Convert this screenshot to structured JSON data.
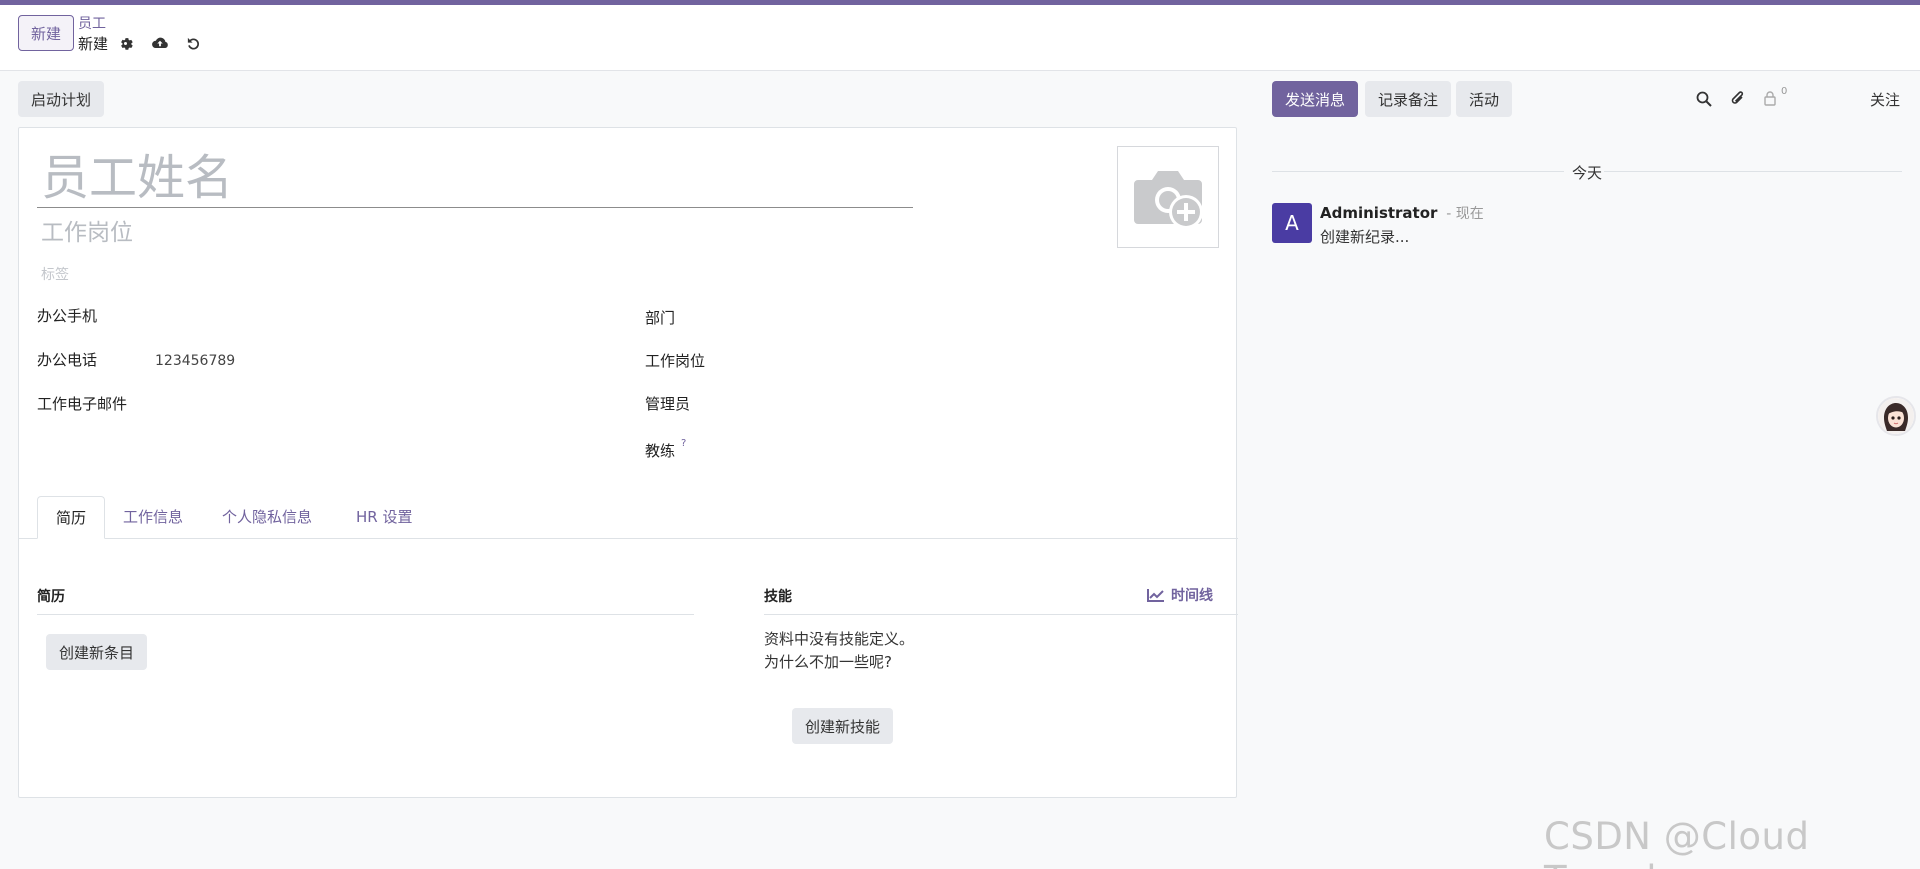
{
  "control_panel": {
    "new_button": "新建",
    "breadcrumb_parent": "员工",
    "breadcrumb_current": "新建",
    "icons": [
      "gear-icon",
      "cloud-upload-icon",
      "undo-icon"
    ]
  },
  "statusbar": {
    "launch_plan": "启动计划"
  },
  "form": {
    "name_placeholder": "员工姓名",
    "job_title_placeholder": "工作岗位",
    "tags_placeholder": "标签",
    "left_fields": [
      {
        "label": "办公手机",
        "value": ""
      },
      {
        "label": "办公电话",
        "value": "123456789"
      },
      {
        "label": "工作电子邮件",
        "value": ""
      }
    ],
    "right_fields": [
      {
        "label": "部门",
        "value": ""
      },
      {
        "label": "工作岗位",
        "value": ""
      },
      {
        "label": "管理员",
        "value": ""
      },
      {
        "label": "教练",
        "value": "",
        "help": "?"
      }
    ],
    "tabs": [
      "简历",
      "工作信息",
      "个人隐私信息",
      "HR 设置"
    ],
    "active_tab": 0,
    "resume": {
      "title": "简历",
      "create_button": "创建新条目"
    },
    "skills": {
      "title": "技能",
      "timeline_link": "时间线",
      "empty_line1": "资料中没有技能定义。",
      "empty_line2": "为什么不加一些呢?",
      "create_button": "创建新技能"
    }
  },
  "chatter": {
    "send_message": "发送消息",
    "log_note": "记录备注",
    "activity": "活动",
    "attachments_count": "",
    "followers_count": "0",
    "follow": "关注",
    "date_separator": "今天",
    "messages": [
      {
        "avatar_letter": "A",
        "author": "Administrator",
        "time": "- 现在",
        "body": "创建新纪录..."
      }
    ]
  },
  "colors": {
    "brand": "#71639e",
    "avatar_bg": "#4a3ca3"
  },
  "watermark": "CSDN @Cloud Traveler"
}
